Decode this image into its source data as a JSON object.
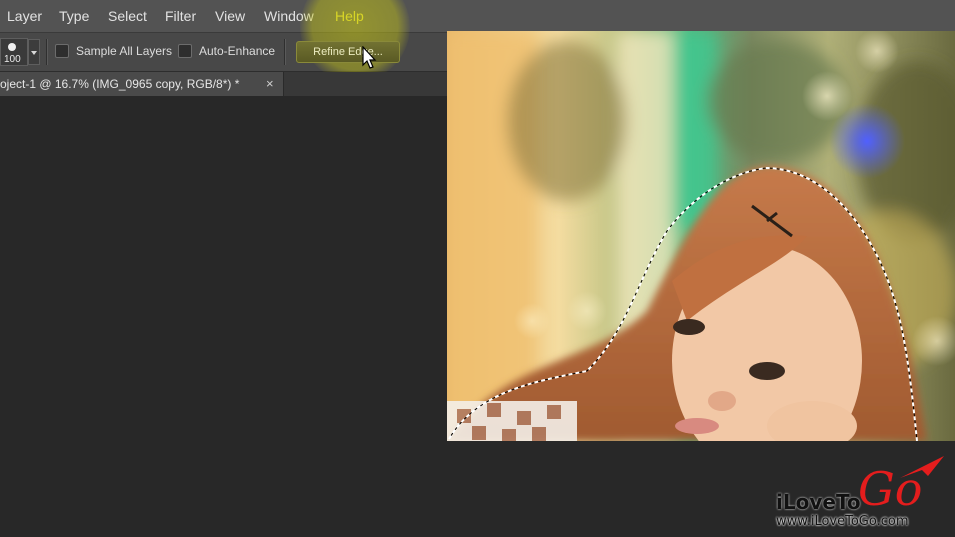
{
  "menu": {
    "items": [
      "Layer",
      "Type",
      "Select",
      "Filter",
      "View",
      "Window",
      "Help"
    ],
    "active": "Help"
  },
  "options": {
    "brush_size": "100",
    "sample_all_layers": "Sample All Layers",
    "auto_enhance": "Auto-Enhance",
    "refine_edge": "Refine Edge..."
  },
  "document": {
    "tab_title": "oject-1 @ 16.7% (IMG_0965 copy, RGB/8*) *",
    "close": "×"
  },
  "watermark": {
    "brand_prefix": "iLoveTo",
    "brand_go": "Go",
    "url": "www.iLoveToGo.com"
  },
  "colors": {
    "highlight": "#c8c814",
    "active_menu": "#e8e33a",
    "logo_red": "#e41d1d"
  },
  "icons": [
    "brush-preset-icon",
    "dropdown-arrow-icon",
    "close-icon",
    "mouse-cursor-icon",
    "red-arrow-icon"
  ]
}
